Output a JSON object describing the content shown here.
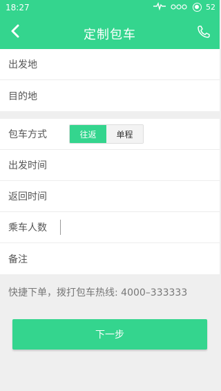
{
  "status_bar": {
    "time": "18:27",
    "battery_percent": "52",
    "icons": [
      "heart-rate-icon",
      "signal-icon",
      "battery-icon"
    ]
  },
  "header": {
    "title": "定制包车",
    "back_icon": "chevron-left-icon",
    "phone_icon": "phone-icon",
    "color": "#34d58e"
  },
  "form": {
    "departure_placeholder": "出发地",
    "destination_placeholder": "目的地",
    "mode_label": "包车方式",
    "mode_options": [
      "往返",
      "单程"
    ],
    "mode_selected": "往返",
    "depart_time_label": "出发时间",
    "return_time_label": "返回时间",
    "passengers_label": "乘车人数",
    "passengers_value": "",
    "remarks_label": "备注"
  },
  "hotline_text": "快捷下单，拨打包车热线: 4000–333333",
  "next_button_label": "下一步"
}
